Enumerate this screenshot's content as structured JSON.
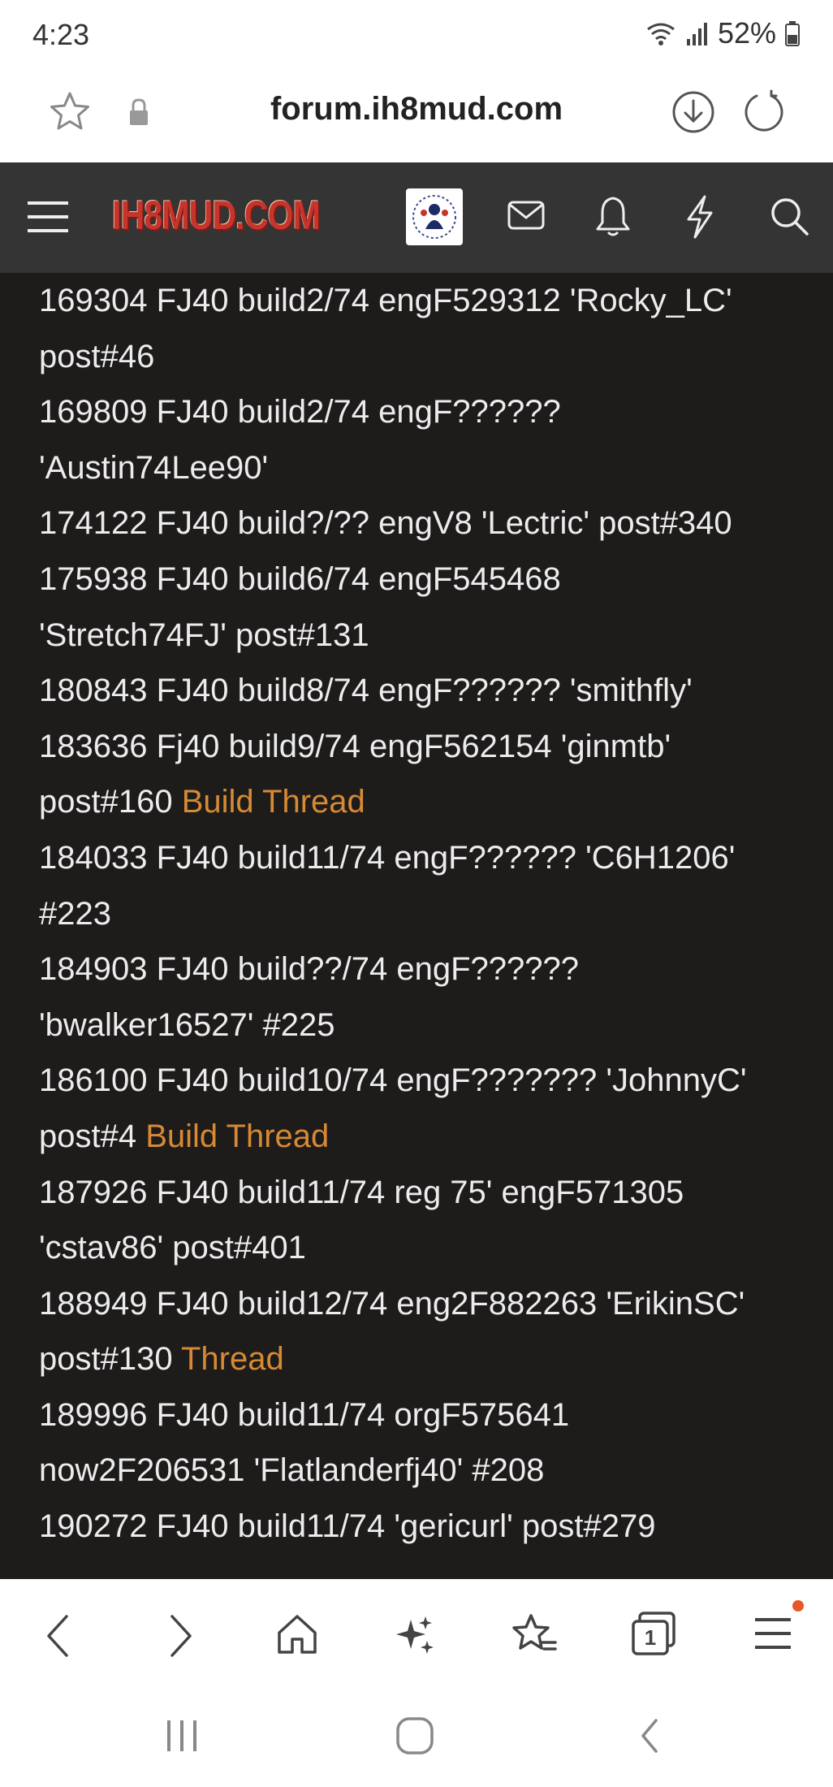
{
  "status_bar": {
    "time": "4:23",
    "battery": "52%"
  },
  "url_bar": {
    "url": "forum.ih8mud.com"
  },
  "forum_header": {
    "logo_text": "IH8MUD.COM"
  },
  "entries": [
    {
      "lines": [
        [
          {
            "text": "169304 FJ40 build2/74 engF529312 'Rocky_LC'"
          }
        ],
        [
          {
            "text": "post#46"
          }
        ]
      ]
    },
    {
      "lines": [
        [
          {
            "text": "169809 FJ40 build2/74 engF??????"
          }
        ],
        [
          {
            "text": "'Austin74Lee90'"
          }
        ]
      ]
    },
    {
      "lines": [
        [
          {
            "text": "174122 FJ40 build?/?? engV8 'Lectric' post#340"
          }
        ]
      ]
    },
    {
      "lines": [
        [
          {
            "text": "175938 FJ40 build6/74 engF545468"
          }
        ],
        [
          {
            "text": "'Stretch74FJ' post#131"
          }
        ]
      ]
    },
    {
      "lines": [
        [
          {
            "text": "180843 FJ40 build8/74 engF?????? 'smithfly'"
          }
        ]
      ]
    },
    {
      "lines": [
        [
          {
            "text": "183636 Fj40 build9/74 engF562154 'ginmtb'"
          }
        ],
        [
          {
            "text": "post#160 "
          },
          {
            "text": "Build Thread",
            "link": true
          }
        ]
      ]
    },
    {
      "lines": [
        [
          {
            "text": "184033 FJ40 build11/74 engF?????? 'C6H1206'"
          }
        ],
        [
          {
            "text": "#223"
          }
        ]
      ]
    },
    {
      "lines": [
        [
          {
            "text": "184903 FJ40 build??/74 engF??????"
          }
        ],
        [
          {
            "text": "'bwalker16527' #225"
          }
        ]
      ]
    },
    {
      "lines": [
        [
          {
            "text": "186100 FJ40 build10/74 engF??????? 'JohnnyC'"
          }
        ],
        [
          {
            "text": "post#4 "
          },
          {
            "text": "Build Thread",
            "link": true
          }
        ]
      ]
    },
    {
      "lines": [
        [
          {
            "text": "187926 FJ40 build11/74 reg 75' engF571305"
          }
        ],
        [
          {
            "text": "'cstav86' post#401"
          }
        ]
      ]
    },
    {
      "lines": [
        [
          {
            "text": "188949 FJ40 build12/74 eng2F882263 'ErikinSC'"
          }
        ],
        [
          {
            "text": "post#130 "
          },
          {
            "text": "Thread",
            "link": true
          }
        ]
      ]
    },
    {
      "lines": [
        [
          {
            "text": "189996 FJ40 build11/74 orgF575641"
          }
        ],
        [
          {
            "text": "now2F206531 'Flatlanderfj40' #208"
          }
        ]
      ]
    },
    {
      "lines": [
        [
          {
            "text": "190272 FJ40 build11/74 'gericurl' post#279"
          }
        ]
      ]
    }
  ],
  "colors": {
    "content_bg": "#1e1b1b",
    "text": "#ececec",
    "link": "#d68a34",
    "header_bg": "#343434",
    "logo_red": "#c7342b",
    "notification_dot": "#e8572a"
  },
  "icons": {
    "status": [
      "wifi-icon",
      "signal-icon",
      "battery-icon"
    ],
    "url_bar": [
      "bookmark-star-icon",
      "lock-icon",
      "download-icon",
      "reload-icon"
    ],
    "forum_header": [
      "hamburger-menu-icon",
      "avatar",
      "envelope-icon",
      "bell-icon",
      "lightning-icon",
      "search-icon"
    ],
    "bottom_nav": [
      "back-arrow-icon",
      "forward-arrow-icon",
      "home-icon",
      "sparkle-icon",
      "bookmarks-icon",
      "tabs-icon",
      "menu-icon"
    ],
    "system_nav": [
      "recents-icon",
      "home-circle-icon",
      "system-back-icon"
    ]
  },
  "tabs_count": "1"
}
